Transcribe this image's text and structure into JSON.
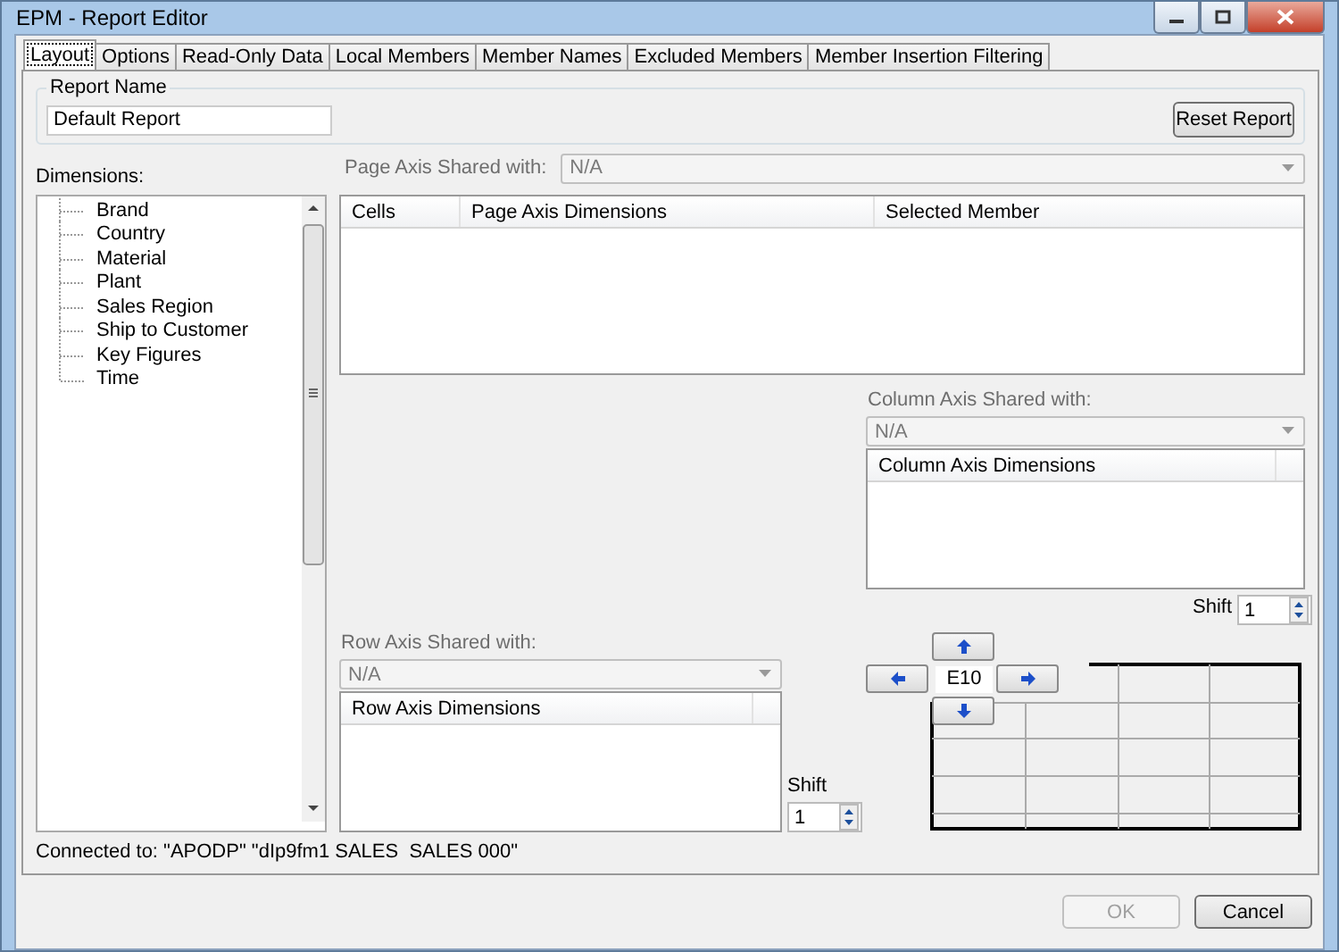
{
  "window": {
    "title": "EPM - Report Editor"
  },
  "tabs": [
    {
      "label": "Layout",
      "selected": true
    },
    {
      "label": "Options",
      "selected": false
    },
    {
      "label": "Read-Only Data",
      "selected": false
    },
    {
      "label": "Local Members",
      "selected": false
    },
    {
      "label": "Member Names",
      "selected": false
    },
    {
      "label": "Excluded Members",
      "selected": false
    },
    {
      "label": "Member Insertion Filtering",
      "selected": false
    }
  ],
  "report_name": {
    "label": "Report Name",
    "value": "Default Report",
    "reset_button": "Reset Report"
  },
  "dimensions": {
    "label": "Dimensions:",
    "items": [
      "Brand",
      "Country",
      "Material",
      "Plant",
      "Sales Region",
      "Ship to Customer",
      "Key Figures",
      "Time"
    ]
  },
  "page_axis": {
    "label": "Page Axis Shared with:",
    "combo": {
      "value": "N/A",
      "disabled": true
    },
    "columns": [
      "Cells",
      "Page Axis Dimensions",
      "Selected Member"
    ]
  },
  "column_axis": {
    "label": "Column Axis Shared with:",
    "combo": {
      "value": "N/A",
      "disabled": true
    },
    "columns": [
      "Column Axis Dimensions"
    ],
    "shift_label": "Shift",
    "shift_value": "1"
  },
  "row_axis": {
    "label": "Row Axis Shared with:",
    "combo": {
      "value": "N/A",
      "disabled": true
    },
    "columns": [
      "Row Axis Dimensions"
    ],
    "shift_label": "Shift",
    "shift_value": "1"
  },
  "navigator": {
    "cell": "E10"
  },
  "status": "Connected to: \"APODP\" \"dIp9fm1 SALES  SALES 000\"",
  "buttons": [
    {
      "label": "OK",
      "disabled": true
    },
    {
      "label": "Cancel",
      "disabled": false
    }
  ]
}
